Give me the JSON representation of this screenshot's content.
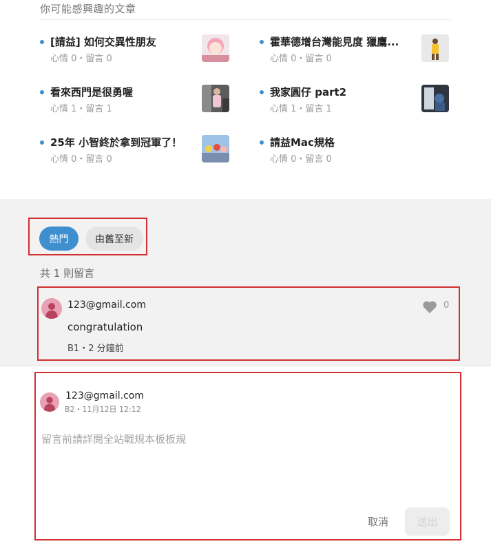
{
  "related": {
    "title": "你可能感興趣的文章",
    "accent": "#3f8ecd",
    "articles": [
      {
        "title": "[請益] 如何交異性朋友",
        "meta": "心情 0・留言 0",
        "thumb": "anime-girl-thumbnail"
      },
      {
        "title": "霍華德增台灣能見度 獵鷹...",
        "meta": "心情 0・留言 0",
        "thumb": "basketball-player-thumbnail"
      },
      {
        "title": "看來西門是很勇喔",
        "meta": "心情 1・留言 1",
        "thumb": "street-photo-thumbnail"
      },
      {
        "title": "我家圓仔 part2",
        "meta": "心情 1・留言 1",
        "thumb": "pet-photo-thumbnail"
      },
      {
        "title": "25年 小智終於拿到冠軍了！",
        "meta": "心情 0・留言 0",
        "thumb": "anime-scene-thumbnail"
      },
      {
        "title": "請益Mac規格",
        "meta": "心情 0・留言 0",
        "thumb": null
      }
    ]
  },
  "comments": {
    "sort": {
      "hot": "熱門",
      "oldest": "由舊至新"
    },
    "count_text": "共 1 則留言",
    "items": [
      {
        "author": "123@gmail.com",
        "text": "congratulation",
        "meta": "B1・2 分鐘前",
        "likes": "0"
      }
    ]
  },
  "reply": {
    "author": "123@gmail.com",
    "meta": "B2・11月12日 12:12",
    "placeholder": "留言前請詳閱全站戰規本板板規",
    "cancel_label": "取消",
    "send_label": "送出"
  },
  "colors": {
    "accent": "#3f8ecd",
    "highlight_border": "#d32f2f",
    "avatar": "#e8a0b4"
  }
}
